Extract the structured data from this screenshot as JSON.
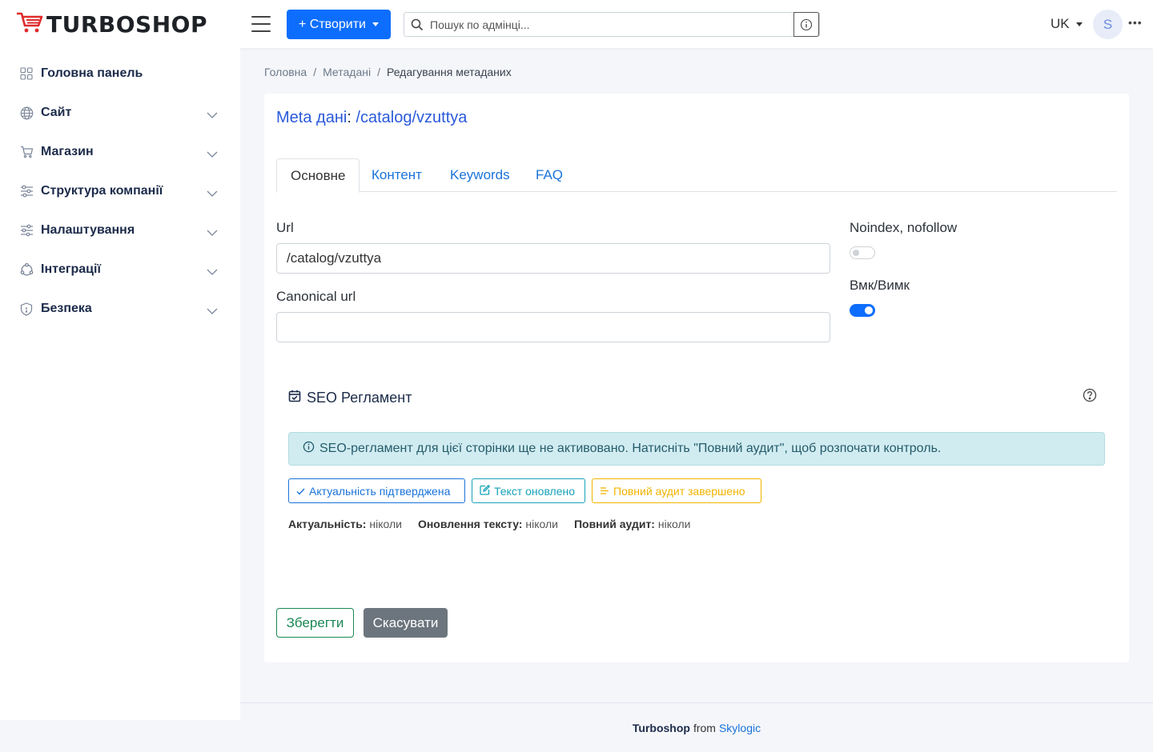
{
  "header": {
    "logo_text": "TURBOSHOP",
    "create_label": "+ Створити",
    "search_placeholder": "Пошук по адмінці...",
    "lang": "UK",
    "avatar_initial": "S",
    "more": "•••"
  },
  "sidebar": {
    "items": [
      {
        "label": "Головна панель",
        "icon": "dashboard-icon"
      },
      {
        "label": "Сайт",
        "icon": "globe-icon"
      },
      {
        "label": "Магазин",
        "icon": "cart-icon"
      },
      {
        "label": "Структура компанії",
        "icon": "sliders-icon"
      },
      {
        "label": "Налаштування",
        "icon": "sliders-icon"
      },
      {
        "label": "Інтеграції",
        "icon": "integrations-icon"
      },
      {
        "label": "Безпека",
        "icon": "shield-icon"
      }
    ]
  },
  "breadcrumb": {
    "home": "Головна",
    "meta": "Метадані",
    "current": "Редагування метаданих",
    "separator": "/"
  },
  "card": {
    "title_label": "Meta дані",
    "title_sep": ":",
    "title_value": "/catalog/vzuttya"
  },
  "tabs": [
    "Основне",
    "Контент",
    "Keywords",
    "FAQ"
  ],
  "form": {
    "url_label": "Url",
    "url_value": "/catalog/vzuttya",
    "canonical_label": "Canonical url",
    "canonical_value": "",
    "noindex_label": "Noindex, nofollow",
    "noindex_on": false,
    "enabled_label": "Вмк/Вимк",
    "enabled_on": true
  },
  "seo": {
    "title": "SEO Регламент",
    "alert": "SEO-регламент для цієї сторінки ще не активовано. Натисніть \"Повний аудит\", щоб розпочати контроль.",
    "chip_actual": "Актуальність підтверджена",
    "chip_text": "Текст оновлено",
    "chip_audit": "Повний аудит завершено",
    "stat_actual_label": "Актуальність:",
    "stat_actual_value": "ніколи",
    "stat_text_label": "Оновлення тексту:",
    "stat_text_value": "ніколи",
    "stat_audit_label": "Повний аудит:",
    "stat_audit_value": "ніколи"
  },
  "actions": {
    "save": "Зберегти",
    "cancel": "Скасувати"
  },
  "footer": {
    "brand": "Turboshop",
    "from": "from",
    "company": "Skylogic"
  },
  "colors": {
    "primary": "#0d6efd",
    "success": "#198754",
    "info": "#17a2b8",
    "warning": "#f0b400",
    "secondary": "#6c757d",
    "logo_red": "#e02b2b"
  }
}
